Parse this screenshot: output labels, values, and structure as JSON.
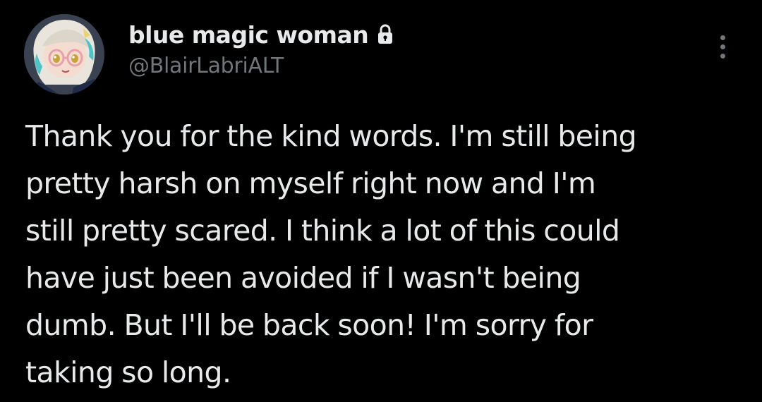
{
  "author": {
    "display_name": "blue magic woman",
    "handle": "@BlairLabriALT",
    "protected_icon": "lock-icon",
    "avatar_icon": "avatar"
  },
  "menu": {
    "icon": "more-vertical-icon"
  },
  "tweet": {
    "text": "Thank you for the kind words. I'm still being\npretty harsh on myself right now and I'm\nstill pretty scared. I think a lot of this could\nhave just been avoided if I wasn't being\ndumb. But I'll be back soon! I'm sorry for\ntaking so long."
  },
  "colors": {
    "background": "#000000",
    "primary_text": "#e7e9ea",
    "secondary_text": "#71767b"
  }
}
